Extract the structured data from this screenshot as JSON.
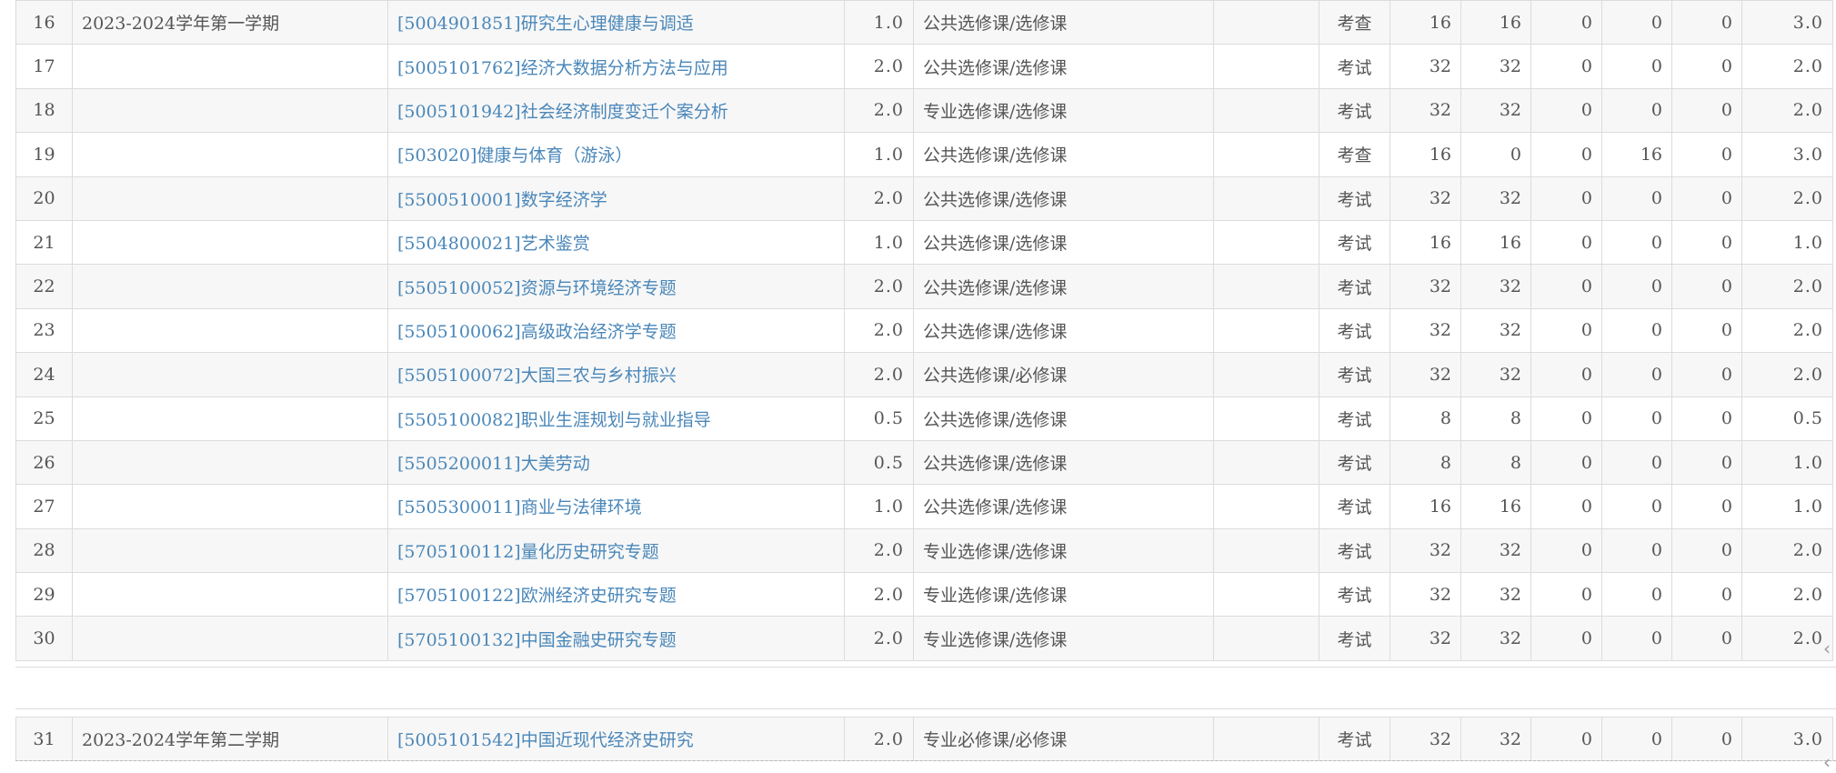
{
  "table_first": {
    "rows": [
      {
        "idx": "16",
        "semester": "2023-2024学年第一学期",
        "course": "[5004901851]研究生心理健康与调适",
        "credit": "1.0",
        "type": "公共选修课/选修课",
        "note": "",
        "exam": "考查",
        "total": "16",
        "lecture": "16",
        "lab": "0",
        "practice": "0",
        "other": "0",
        "score": "3.0"
      },
      {
        "idx": "17",
        "semester": "",
        "course": "[5005101762]经济大数据分析方法与应用",
        "credit": "2.0",
        "type": "公共选修课/选修课",
        "note": "",
        "exam": "考试",
        "total": "32",
        "lecture": "32",
        "lab": "0",
        "practice": "0",
        "other": "0",
        "score": "2.0"
      },
      {
        "idx": "18",
        "semester": "",
        "course": "[5005101942]社会经济制度变迁个案分析",
        "credit": "2.0",
        "type": "专业选修课/选修课",
        "note": "",
        "exam": "考试",
        "total": "32",
        "lecture": "32",
        "lab": "0",
        "practice": "0",
        "other": "0",
        "score": "2.0"
      },
      {
        "idx": "19",
        "semester": "",
        "course": "[503020]健康与体育（游泳）",
        "credit": "1.0",
        "type": "公共选修课/选修课",
        "note": "",
        "exam": "考查",
        "total": "16",
        "lecture": "0",
        "lab": "0",
        "practice": "16",
        "other": "0",
        "score": "3.0"
      },
      {
        "idx": "20",
        "semester": "",
        "course": "[5500510001]数字经济学",
        "credit": "2.0",
        "type": "公共选修课/选修课",
        "note": "",
        "exam": "考试",
        "total": "32",
        "lecture": "32",
        "lab": "0",
        "practice": "0",
        "other": "0",
        "score": "2.0"
      },
      {
        "idx": "21",
        "semester": "",
        "course": "[5504800021]艺术鉴赏",
        "credit": "1.0",
        "type": "公共选修课/选修课",
        "note": "",
        "exam": "考试",
        "total": "16",
        "lecture": "16",
        "lab": "0",
        "practice": "0",
        "other": "0",
        "score": "1.0"
      },
      {
        "idx": "22",
        "semester": "",
        "course": "[5505100052]资源与环境经济专题",
        "credit": "2.0",
        "type": "公共选修课/选修课",
        "note": "",
        "exam": "考试",
        "total": "32",
        "lecture": "32",
        "lab": "0",
        "practice": "0",
        "other": "0",
        "score": "2.0"
      },
      {
        "idx": "23",
        "semester": "",
        "course": "[5505100062]高级政治经济学专题",
        "credit": "2.0",
        "type": "公共选修课/选修课",
        "note": "",
        "exam": "考试",
        "total": "32",
        "lecture": "32",
        "lab": "0",
        "practice": "0",
        "other": "0",
        "score": "2.0"
      },
      {
        "idx": "24",
        "semester": "",
        "course": "[5505100072]大国三农与乡村振兴",
        "credit": "2.0",
        "type": "公共选修课/必修课",
        "note": "",
        "exam": "考试",
        "total": "32",
        "lecture": "32",
        "lab": "0",
        "practice": "0",
        "other": "0",
        "score": "2.0"
      },
      {
        "idx": "25",
        "semester": "",
        "course": "[5505100082]职业生涯规划与就业指导",
        "credit": "0.5",
        "type": "公共选修课/选修课",
        "note": "",
        "exam": "考试",
        "total": "8",
        "lecture": "8",
        "lab": "0",
        "practice": "0",
        "other": "0",
        "score": "0.5"
      },
      {
        "idx": "26",
        "semester": "",
        "course": "[5505200011]大美劳动",
        "credit": "0.5",
        "type": "公共选修课/选修课",
        "note": "",
        "exam": "考试",
        "total": "8",
        "lecture": "8",
        "lab": "0",
        "practice": "0",
        "other": "0",
        "score": "1.0"
      },
      {
        "idx": "27",
        "semester": "",
        "course": "[5505300011]商业与法律环境",
        "credit": "1.0",
        "type": "公共选修课/选修课",
        "note": "",
        "exam": "考试",
        "total": "16",
        "lecture": "16",
        "lab": "0",
        "practice": "0",
        "other": "0",
        "score": "1.0"
      },
      {
        "idx": "28",
        "semester": "",
        "course": "[5705100112]量化历史研究专题",
        "credit": "2.0",
        "type": "专业选修课/选修课",
        "note": "",
        "exam": "考试",
        "total": "32",
        "lecture": "32",
        "lab": "0",
        "practice": "0",
        "other": "0",
        "score": "2.0"
      },
      {
        "idx": "29",
        "semester": "",
        "course": "[5705100122]欧洲经济史研究专题",
        "credit": "2.0",
        "type": "专业选修课/选修课",
        "note": "",
        "exam": "考试",
        "total": "32",
        "lecture": "32",
        "lab": "0",
        "practice": "0",
        "other": "0",
        "score": "2.0"
      },
      {
        "idx": "30",
        "semester": "",
        "course": "[5705100132]中国金融史研究专题",
        "credit": "2.0",
        "type": "专业选修课/选修课",
        "note": "",
        "exam": "考试",
        "total": "32",
        "lecture": "32",
        "lab": "0",
        "practice": "0",
        "other": "0",
        "score": "2.0"
      }
    ]
  },
  "table_second": {
    "rows": [
      {
        "idx": "31",
        "semester": "2023-2024学年第二学期",
        "course": "[5005101542]中国近现代经济史研究",
        "credit": "2.0",
        "type": "专业必修课/必修课",
        "note": "",
        "exam": "考试",
        "total": "32",
        "lecture": "32",
        "lab": "0",
        "practice": "0",
        "other": "0",
        "score": "3.0"
      }
    ]
  },
  "icons": {
    "scroll_arrow": "chevron-left-icon"
  }
}
